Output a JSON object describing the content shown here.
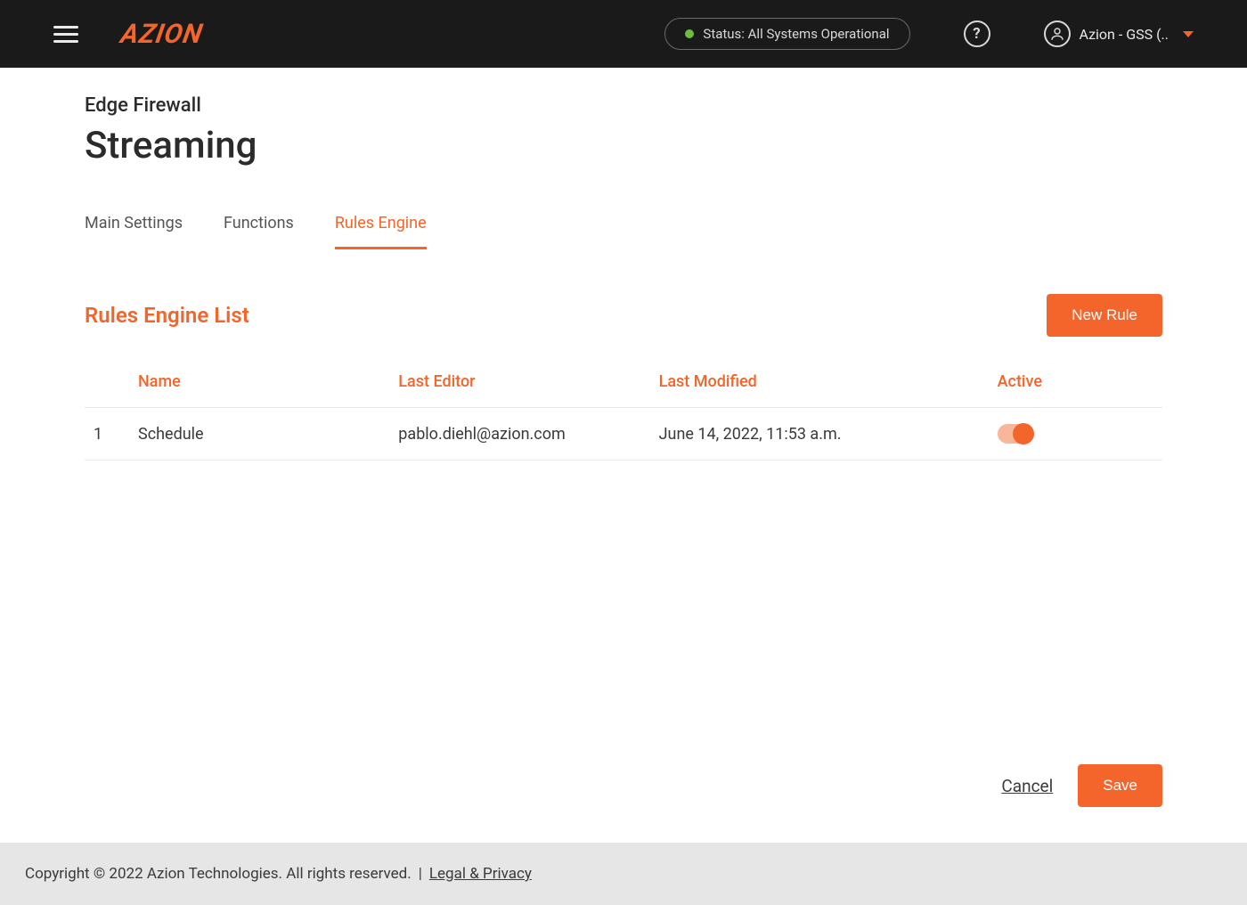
{
  "header": {
    "logo_text": "AZION",
    "status_text": "Status: All Systems Operational",
    "help_label": "?",
    "account_label": "Azion - GSS (.."
  },
  "page": {
    "breadcrumb": "Edge Firewall",
    "title": "Streaming"
  },
  "tabs": [
    {
      "label": "Main Settings",
      "active": false
    },
    {
      "label": "Functions",
      "active": false
    },
    {
      "label": "Rules Engine",
      "active": true
    }
  ],
  "section": {
    "title": "Rules Engine List",
    "new_button": "New Rule"
  },
  "table": {
    "columns": {
      "index": "",
      "name": "Name",
      "last_editor": "Last Editor",
      "last_modified": "Last Modified",
      "active": "Active"
    },
    "rows": [
      {
        "index": "1",
        "name": "Schedule",
        "last_editor": "pablo.diehl@azion.com",
        "last_modified": "June 14, 2022, 11:53 a.m.",
        "active": true
      }
    ]
  },
  "actions": {
    "cancel": "Cancel",
    "save": "Save"
  },
  "footer": {
    "copyright": "Copyright © 2022 Azion Technologies. All rights reserved.",
    "separator": "|",
    "legal": "Legal & Privacy"
  }
}
